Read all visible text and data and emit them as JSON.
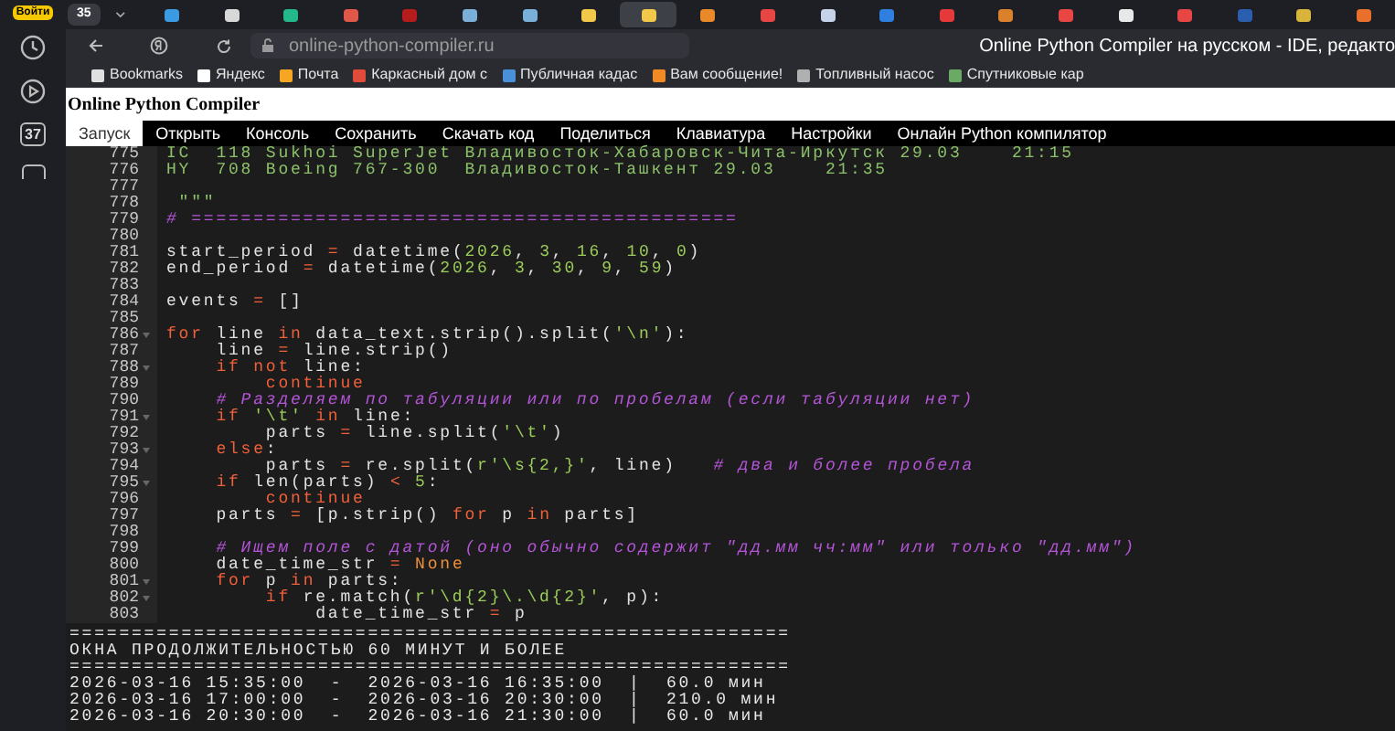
{
  "sidebar": {
    "login": "Войти",
    "items": [
      {
        "kind": "clock"
      },
      {
        "kind": "play"
      },
      {
        "kind": "badge",
        "text": "37"
      },
      {
        "kind": "square"
      }
    ]
  },
  "tab_strip": {
    "counter": "35",
    "tabs": [
      {
        "color": "#3b9ae1",
        "selected": false
      },
      {
        "color": "#d8d8d8",
        "selected": false
      },
      {
        "color": "#22b88a",
        "selected": false
      },
      {
        "color": "#e0584a",
        "selected": false
      },
      {
        "color": "#b51c1c",
        "selected": false
      },
      {
        "color": "#7ab0d8",
        "selected": false
      },
      {
        "color": "#7ab0d8",
        "selected": false
      },
      {
        "color": "#f2c84b",
        "selected": false
      },
      {
        "color": "#f2c84b",
        "selected": true
      },
      {
        "color": "#e8892a",
        "selected": false
      },
      {
        "color": "#e84545",
        "selected": false
      },
      {
        "color": "#c6d2e8",
        "selected": false
      },
      {
        "color": "#2f7fe0",
        "selected": false
      },
      {
        "color": "#e63a3a",
        "selected": false
      },
      {
        "color": "#d9822b",
        "selected": false
      },
      {
        "color": "#e84545",
        "selected": false
      },
      {
        "color": "#e8e8e8",
        "selected": false
      },
      {
        "color": "#e84545",
        "selected": false
      },
      {
        "color": "#2a5fb0",
        "selected": false
      },
      {
        "color": "#d9b43a",
        "selected": false
      },
      {
        "color": "#e8702a",
        "selected": false
      }
    ]
  },
  "address_bar": {
    "url": "online-python-compiler.ru",
    "page_title": "Online Python Compiler на русском - IDE, редакто"
  },
  "bookmarks": [
    {
      "label": "Bookmarks",
      "color": "#e0e0e0"
    },
    {
      "label": "Яндекс",
      "color": "#ffffff"
    },
    {
      "label": "Почта",
      "color": "#f5a623"
    },
    {
      "label": "Каркасный дом с",
      "color": "#e04b3a"
    },
    {
      "label": "Публичная кадас",
      "color": "#4a90d9"
    },
    {
      "label": "Вам сообщение!",
      "color": "#f08a24"
    },
    {
      "label": "Топливный насос",
      "color": "#b0b0b0"
    },
    {
      "label": "Спутниковые кар",
      "color": "#6aaa64"
    }
  ],
  "page": {
    "title": "Online Python Compiler",
    "menu": [
      {
        "label": "Запуск",
        "selected": true
      },
      {
        "label": "Открыть",
        "selected": false
      },
      {
        "label": "Консоль",
        "selected": false
      },
      {
        "label": "Сохранить",
        "selected": false
      },
      {
        "label": "Скачать код",
        "selected": false
      },
      {
        "label": "Поделиться",
        "selected": false
      },
      {
        "label": "Клавиатура",
        "selected": false
      },
      {
        "label": "Настройки",
        "selected": false
      },
      {
        "label": "Онлайн Python компилятор",
        "selected": false
      }
    ]
  },
  "editor": {
    "lines": [
      {
        "number": "775",
        "fold": false,
        "tokens": [
          {
            "kind": "data",
            "text": "IC  118 Sukhoi SuperJet Владивосток-Хабаровск-Чита-Иркутск 29.03    21:15"
          }
        ]
      },
      {
        "number": "776",
        "fold": false,
        "tokens": [
          {
            "kind": "data",
            "text": "HY  708 Boeing 767-300  Владивосток-Ташкент 29.03    21:35"
          }
        ]
      },
      {
        "number": "777",
        "fold": false
      },
      {
        "number": "778",
        "fold": false,
        "tokens": [
          {
            "kind": "data",
            "text": " \"\"\""
          }
        ]
      },
      {
        "number": "779",
        "fold": false,
        "tokens": [
          {
            "kind": "comment",
            "text": "# ============================================"
          }
        ]
      },
      {
        "number": "780",
        "fold": false
      },
      {
        "number": "781",
        "fold": false,
        "tokens": [
          {
            "kind": "plain",
            "text": "start_period "
          },
          {
            "kind": "operator",
            "text": "="
          },
          {
            "kind": "plain",
            "text": " datetime("
          },
          {
            "kind": "number",
            "text": "2026"
          },
          {
            "kind": "plain",
            "text": ", "
          },
          {
            "kind": "number",
            "text": "3"
          },
          {
            "kind": "plain",
            "text": ", "
          },
          {
            "kind": "number",
            "text": "16"
          },
          {
            "kind": "plain",
            "text": ", "
          },
          {
            "kind": "number",
            "text": "10"
          },
          {
            "kind": "plain",
            "text": ", "
          },
          {
            "kind": "number",
            "text": "0"
          },
          {
            "kind": "plain",
            "text": ")"
          }
        ]
      },
      {
        "number": "782",
        "fold": false,
        "tokens": [
          {
            "kind": "plain",
            "text": "end_period "
          },
          {
            "kind": "operator",
            "text": "="
          },
          {
            "kind": "plain",
            "text": " datetime("
          },
          {
            "kind": "number",
            "text": "2026"
          },
          {
            "kind": "plain",
            "text": ", "
          },
          {
            "kind": "number",
            "text": "3"
          },
          {
            "kind": "plain",
            "text": ", "
          },
          {
            "kind": "number",
            "text": "30"
          },
          {
            "kind": "plain",
            "text": ", "
          },
          {
            "kind": "number",
            "text": "9"
          },
          {
            "kind": "plain",
            "text": ", "
          },
          {
            "kind": "number",
            "text": "59"
          },
          {
            "kind": "plain",
            "text": ")"
          }
        ]
      },
      {
        "number": "783",
        "fold": false
      },
      {
        "number": "784",
        "fold": false,
        "tokens": [
          {
            "kind": "plain",
            "text": "events "
          },
          {
            "kind": "operator",
            "text": "="
          },
          {
            "kind": "plain",
            "text": " []"
          }
        ]
      },
      {
        "number": "785",
        "fold": false
      },
      {
        "number": "786",
        "fold": true,
        "tokens": [
          {
            "kind": "keyword",
            "text": "for"
          },
          {
            "kind": "plain",
            "text": " line "
          },
          {
            "kind": "keyword",
            "text": "in"
          },
          {
            "kind": "plain",
            "text": " data_text.strip().split("
          },
          {
            "kind": "string",
            "text": "'\\n'"
          },
          {
            "kind": "plain",
            "text": "):"
          }
        ]
      },
      {
        "number": "787",
        "fold": false,
        "tokens": [
          {
            "kind": "plain",
            "text": "    line "
          },
          {
            "kind": "operator",
            "text": "="
          },
          {
            "kind": "plain",
            "text": " line.strip()"
          }
        ]
      },
      {
        "number": "788",
        "fold": true,
        "tokens": [
          {
            "kind": "keyword",
            "text": "    if not"
          },
          {
            "kind": "plain",
            "text": " line:"
          }
        ]
      },
      {
        "number": "789",
        "fold": false,
        "tokens": [
          {
            "kind": "keyword",
            "text": "        continue"
          }
        ]
      },
      {
        "number": "790",
        "fold": false,
        "tokens": [
          {
            "kind": "comment",
            "text": "    # Разделяем по табуляции или по пробелам (если табуляции нет)"
          }
        ]
      },
      {
        "number": "791",
        "fold": true,
        "tokens": [
          {
            "kind": "keyword",
            "text": "    if"
          },
          {
            "kind": "string",
            "text": " '\\t'"
          },
          {
            "kind": "keyword",
            "text": " in"
          },
          {
            "kind": "plain",
            "text": " line:"
          }
        ]
      },
      {
        "number": "792",
        "fold": false,
        "tokens": [
          {
            "kind": "plain",
            "text": "        parts "
          },
          {
            "kind": "operator",
            "text": "="
          },
          {
            "kind": "plain",
            "text": " line.split("
          },
          {
            "kind": "string",
            "text": "'\\t'"
          },
          {
            "kind": "plain",
            "text": ")"
          }
        ]
      },
      {
        "number": "793",
        "fold": true,
        "tokens": [
          {
            "kind": "keyword",
            "text": "    else"
          },
          {
            "kind": "plain",
            "text": ":"
          }
        ]
      },
      {
        "number": "794",
        "fold": false,
        "tokens": [
          {
            "kind": "plain",
            "text": "        parts "
          },
          {
            "kind": "operator",
            "text": "="
          },
          {
            "kind": "plain",
            "text": " re.split("
          },
          {
            "kind": "string",
            "text": "r'\\s{2,}'"
          },
          {
            "kind": "plain",
            "text": ", line)"
          },
          {
            "kind": "comment",
            "text": "   # два и более пробела"
          }
        ]
      },
      {
        "number": "795",
        "fold": true,
        "tokens": [
          {
            "kind": "keyword",
            "text": "    if"
          },
          {
            "kind": "plain",
            "text": " len(parts) "
          },
          {
            "kind": "operator",
            "text": "<"
          },
          {
            "kind": "number",
            "text": " 5"
          },
          {
            "kind": "plain",
            "text": ":"
          }
        ]
      },
      {
        "number": "796",
        "fold": false,
        "tokens": [
          {
            "kind": "keyword",
            "text": "        continue"
          }
        ]
      },
      {
        "number": "797",
        "fold": false,
        "tokens": [
          {
            "kind": "plain",
            "text": "    parts "
          },
          {
            "kind": "operator",
            "text": "="
          },
          {
            "kind": "plain",
            "text": " [p.strip() "
          },
          {
            "kind": "keyword",
            "text": "for"
          },
          {
            "kind": "plain",
            "text": " p "
          },
          {
            "kind": "keyword",
            "text": "in"
          },
          {
            "kind": "plain",
            "text": " parts]"
          }
        ]
      },
      {
        "number": "798",
        "fold": false
      },
      {
        "number": "799",
        "fold": false,
        "tokens": [
          {
            "kind": "comment",
            "text": "    # Ищем поле с датой (оно обычно содержит \"дд.мм чч:мм\" или только \"дд.мм\")"
          }
        ]
      },
      {
        "number": "800",
        "fold": false,
        "tokens": [
          {
            "kind": "plain",
            "text": "    date_time_str "
          },
          {
            "kind": "operator",
            "text": "="
          },
          {
            "kind": "constant",
            "text": " None"
          }
        ]
      },
      {
        "number": "801",
        "fold": true,
        "tokens": [
          {
            "kind": "keyword",
            "text": "    for"
          },
          {
            "kind": "plain",
            "text": " p "
          },
          {
            "kind": "keyword",
            "text": "in"
          },
          {
            "kind": "plain",
            "text": " parts:"
          }
        ]
      },
      {
        "number": "802",
        "fold": true,
        "tokens": [
          {
            "kind": "keyword",
            "text": "        if"
          },
          {
            "kind": "plain",
            "text": " re.match("
          },
          {
            "kind": "string",
            "text": "r'\\d{2}\\.\\d{2}'"
          },
          {
            "kind": "plain",
            "text": ", p):"
          }
        ]
      },
      {
        "number": "803",
        "fold": false,
        "tokens": [
          {
            "kind": "plain",
            "text": "            date_time_str "
          },
          {
            "kind": "operator",
            "text": "="
          },
          {
            "kind": "plain",
            "text": " p"
          }
        ]
      }
    ]
  },
  "console": {
    "lines": [
      "==========================================================",
      "ОКНА ПРОДОЛЖИТЕЛЬНОСТЬЮ 60 МИНУТ И БОЛЕЕ",
      "==========================================================",
      "2026-03-16 15:35:00  -  2026-03-16 16:35:00  |  60.0 мин",
      "2026-03-16 17:00:00  -  2026-03-16 20:30:00  |  210.0 мин",
      "2026-03-16 20:30:00  -  2026-03-16 21:30:00  |  60.0 мин"
    ]
  }
}
